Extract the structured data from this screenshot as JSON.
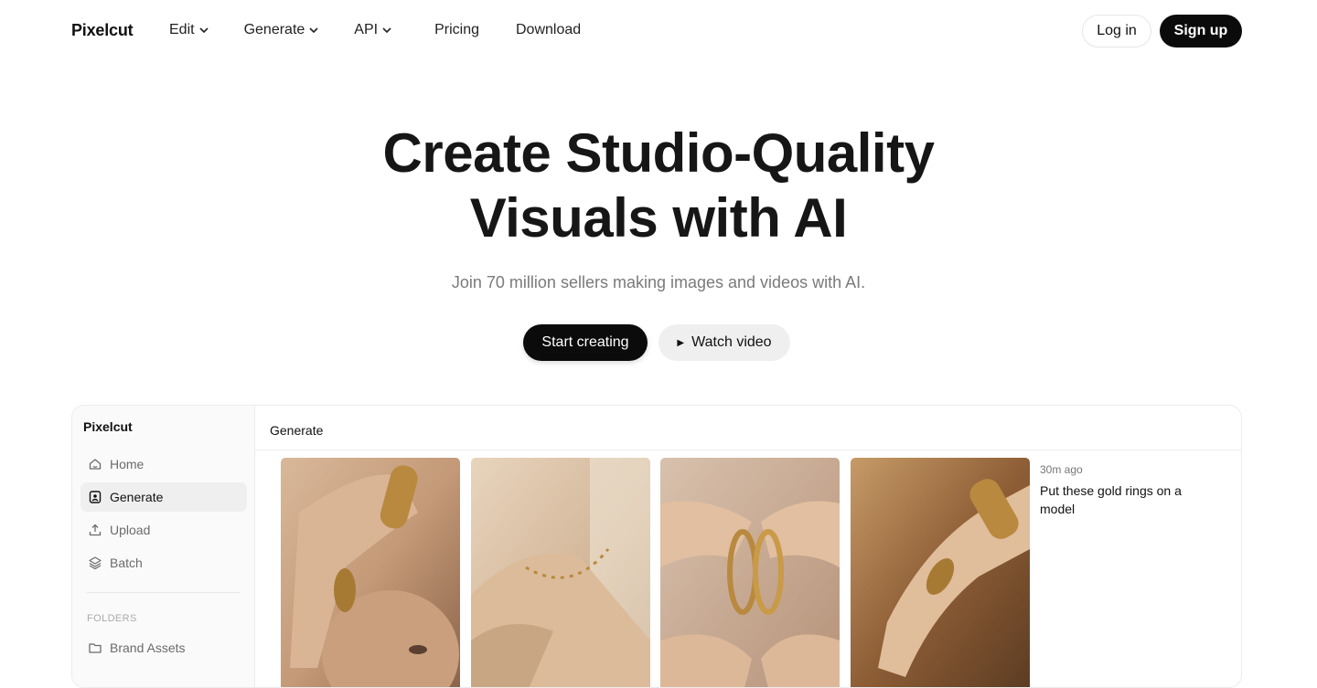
{
  "header": {
    "logo": "Pixelcut",
    "nav": [
      {
        "label": "Edit",
        "dropdown": true
      },
      {
        "label": "Generate",
        "dropdown": true
      },
      {
        "label": "API",
        "dropdown": true
      },
      {
        "label": "Pricing",
        "dropdown": false
      },
      {
        "label": "Download",
        "dropdown": false
      }
    ],
    "login_label": "Log in",
    "signup_label": "Sign up"
  },
  "hero": {
    "title_line1": "Create Studio-Quality",
    "title_line2": "Visuals with AI",
    "subtitle": "Join 70 million sellers making images and videos with AI.",
    "start_label": "Start creating",
    "watch_label": "Watch video"
  },
  "app": {
    "sidebar": {
      "logo": "Pixelcut",
      "items": [
        {
          "label": "Home",
          "icon": "home-icon",
          "active": false
        },
        {
          "label": "Generate",
          "icon": "generate-icon",
          "active": true
        },
        {
          "label": "Upload",
          "icon": "upload-icon",
          "active": false
        },
        {
          "label": "Batch",
          "icon": "layers-icon",
          "active": false
        }
      ],
      "folders_heading": "FOLDERS",
      "folders": [
        {
          "label": "Brand Assets",
          "icon": "folder-icon"
        }
      ]
    },
    "main": {
      "title": "Generate",
      "images": [
        {
          "subject": "woman with gold cuff and ring"
        },
        {
          "subject": "gold anklet on foot"
        },
        {
          "subject": "gold hoop earrings held in hands"
        },
        {
          "subject": "hand with gold cuff and ring"
        }
      ],
      "time_ago": "30m ago",
      "prompt": "Put these gold rings on a model"
    }
  },
  "colors": {
    "primary_button": "#0b0b0b",
    "secondary_button": "#efefef",
    "muted_text": "#7a7a7a"
  }
}
